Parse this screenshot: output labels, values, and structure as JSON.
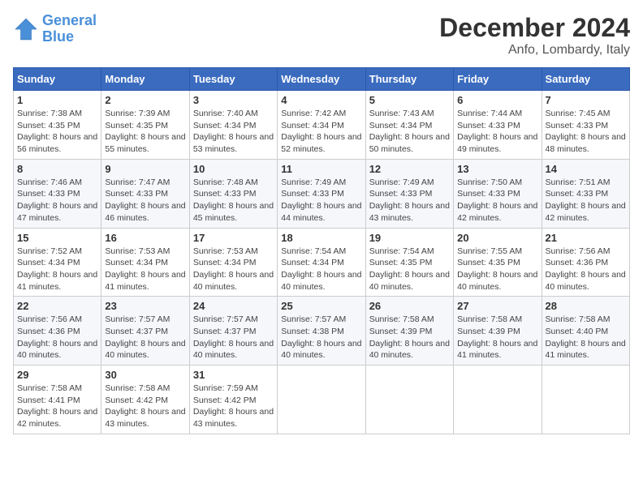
{
  "header": {
    "logo_line1": "General",
    "logo_line2": "Blue",
    "month": "December 2024",
    "location": "Anfo, Lombardy, Italy"
  },
  "weekdays": [
    "Sunday",
    "Monday",
    "Tuesday",
    "Wednesday",
    "Thursday",
    "Friday",
    "Saturday"
  ],
  "weeks": [
    [
      {
        "day": "1",
        "sunrise": "7:38 AM",
        "sunset": "4:35 PM",
        "daylight": "8 hours and 56 minutes."
      },
      {
        "day": "2",
        "sunrise": "7:39 AM",
        "sunset": "4:35 PM",
        "daylight": "8 hours and 55 minutes."
      },
      {
        "day": "3",
        "sunrise": "7:40 AM",
        "sunset": "4:34 PM",
        "daylight": "8 hours and 53 minutes."
      },
      {
        "day": "4",
        "sunrise": "7:42 AM",
        "sunset": "4:34 PM",
        "daylight": "8 hours and 52 minutes."
      },
      {
        "day": "5",
        "sunrise": "7:43 AM",
        "sunset": "4:34 PM",
        "daylight": "8 hours and 50 minutes."
      },
      {
        "day": "6",
        "sunrise": "7:44 AM",
        "sunset": "4:33 PM",
        "daylight": "8 hours and 49 minutes."
      },
      {
        "day": "7",
        "sunrise": "7:45 AM",
        "sunset": "4:33 PM",
        "daylight": "8 hours and 48 minutes."
      }
    ],
    [
      {
        "day": "8",
        "sunrise": "7:46 AM",
        "sunset": "4:33 PM",
        "daylight": "8 hours and 47 minutes."
      },
      {
        "day": "9",
        "sunrise": "7:47 AM",
        "sunset": "4:33 PM",
        "daylight": "8 hours and 46 minutes."
      },
      {
        "day": "10",
        "sunrise": "7:48 AM",
        "sunset": "4:33 PM",
        "daylight": "8 hours and 45 minutes."
      },
      {
        "day": "11",
        "sunrise": "7:49 AM",
        "sunset": "4:33 PM",
        "daylight": "8 hours and 44 minutes."
      },
      {
        "day": "12",
        "sunrise": "7:49 AM",
        "sunset": "4:33 PM",
        "daylight": "8 hours and 43 minutes."
      },
      {
        "day": "13",
        "sunrise": "7:50 AM",
        "sunset": "4:33 PM",
        "daylight": "8 hours and 42 minutes."
      },
      {
        "day": "14",
        "sunrise": "7:51 AM",
        "sunset": "4:33 PM",
        "daylight": "8 hours and 42 minutes."
      }
    ],
    [
      {
        "day": "15",
        "sunrise": "7:52 AM",
        "sunset": "4:34 PM",
        "daylight": "8 hours and 41 minutes."
      },
      {
        "day": "16",
        "sunrise": "7:53 AM",
        "sunset": "4:34 PM",
        "daylight": "8 hours and 41 minutes."
      },
      {
        "day": "17",
        "sunrise": "7:53 AM",
        "sunset": "4:34 PM",
        "daylight": "8 hours and 40 minutes."
      },
      {
        "day": "18",
        "sunrise": "7:54 AM",
        "sunset": "4:34 PM",
        "daylight": "8 hours and 40 minutes."
      },
      {
        "day": "19",
        "sunrise": "7:54 AM",
        "sunset": "4:35 PM",
        "daylight": "8 hours and 40 minutes."
      },
      {
        "day": "20",
        "sunrise": "7:55 AM",
        "sunset": "4:35 PM",
        "daylight": "8 hours and 40 minutes."
      },
      {
        "day": "21",
        "sunrise": "7:56 AM",
        "sunset": "4:36 PM",
        "daylight": "8 hours and 40 minutes."
      }
    ],
    [
      {
        "day": "22",
        "sunrise": "7:56 AM",
        "sunset": "4:36 PM",
        "daylight": "8 hours and 40 minutes."
      },
      {
        "day": "23",
        "sunrise": "7:57 AM",
        "sunset": "4:37 PM",
        "daylight": "8 hours and 40 minutes."
      },
      {
        "day": "24",
        "sunrise": "7:57 AM",
        "sunset": "4:37 PM",
        "daylight": "8 hours and 40 minutes."
      },
      {
        "day": "25",
        "sunrise": "7:57 AM",
        "sunset": "4:38 PM",
        "daylight": "8 hours and 40 minutes."
      },
      {
        "day": "26",
        "sunrise": "7:58 AM",
        "sunset": "4:39 PM",
        "daylight": "8 hours and 40 minutes."
      },
      {
        "day": "27",
        "sunrise": "7:58 AM",
        "sunset": "4:39 PM",
        "daylight": "8 hours and 41 minutes."
      },
      {
        "day": "28",
        "sunrise": "7:58 AM",
        "sunset": "4:40 PM",
        "daylight": "8 hours and 41 minutes."
      }
    ],
    [
      {
        "day": "29",
        "sunrise": "7:58 AM",
        "sunset": "4:41 PM",
        "daylight": "8 hours and 42 minutes."
      },
      {
        "day": "30",
        "sunrise": "7:58 AM",
        "sunset": "4:42 PM",
        "daylight": "8 hours and 43 minutes."
      },
      {
        "day": "31",
        "sunrise": "7:59 AM",
        "sunset": "4:42 PM",
        "daylight": "8 hours and 43 minutes."
      },
      null,
      null,
      null,
      null
    ]
  ],
  "labels": {
    "sunrise": "Sunrise: ",
    "sunset": "Sunset: ",
    "daylight": "Daylight: "
  }
}
